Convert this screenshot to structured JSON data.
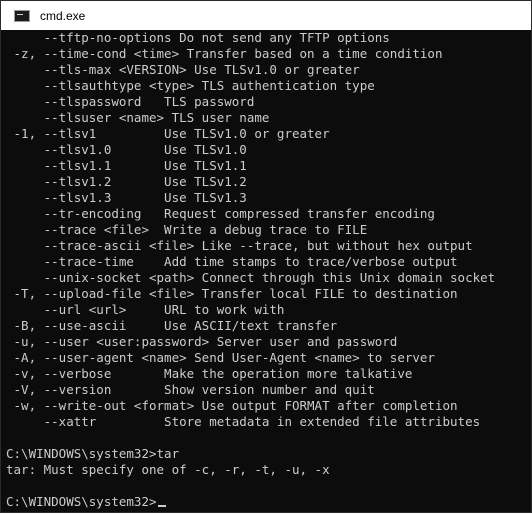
{
  "window": {
    "title": "cmd.exe",
    "icon": "console-icon"
  },
  "colors": {
    "console_bg": "#0c0c0c",
    "console_text": "#cccccc",
    "titlebar_bg": "#ffffff"
  },
  "console": {
    "lines": [
      "     --tftp-no-options Do not send any TFTP options",
      " -z, --time-cond <time> Transfer based on a time condition",
      "     --tls-max <VERSION> Use TLSv1.0 or greater",
      "     --tlsauthtype <type> TLS authentication type",
      "     --tlspassword   TLS password",
      "     --tlsuser <name> TLS user name",
      " -1, --tlsv1         Use TLSv1.0 or greater",
      "     --tlsv1.0       Use TLSv1.0",
      "     --tlsv1.1       Use TLSv1.1",
      "     --tlsv1.2       Use TLSv1.2",
      "     --tlsv1.3       Use TLSv1.3",
      "     --tr-encoding   Request compressed transfer encoding",
      "     --trace <file>  Write a debug trace to FILE",
      "     --trace-ascii <file> Like --trace, but without hex output",
      "     --trace-time    Add time stamps to trace/verbose output",
      "     --unix-socket <path> Connect through this Unix domain socket",
      " -T, --upload-file <file> Transfer local FILE to destination",
      "     --url <url>     URL to work with",
      " -B, --use-ascii     Use ASCII/text transfer",
      " -u, --user <user:password> Server user and password",
      " -A, --user-agent <name> Send User-Agent <name> to server",
      " -v, --verbose       Make the operation more talkative",
      " -V, --version       Show version number and quit",
      " -w, --write-out <format> Use output FORMAT after completion",
      "     --xattr         Store metadata in extended file attributes",
      "",
      "C:\\WINDOWS\\system32>tar",
      "tar: Must specify one of -c, -r, -t, -u, -x",
      ""
    ],
    "prompt": "C:\\WINDOWS\\system32>"
  }
}
